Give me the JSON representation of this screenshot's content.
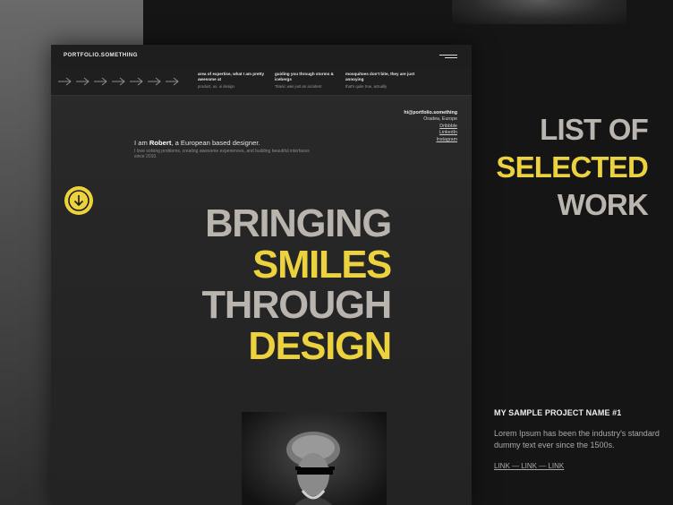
{
  "site": {
    "brand": "PORTFOLIO.SOMETHING",
    "ticker": [
      {
        "head": "area of expertise, what I am pretty awesome at",
        "sub": "product, ux, ui design"
      },
      {
        "head": "guiding you through storms & icebergs",
        "sub": "Titanic was just an accident"
      },
      {
        "head": "mosquitoes don't bite, they are just annoying",
        "sub": "that's quite true, actually"
      }
    ],
    "contact": {
      "email": "hi@portfolio.something",
      "location": "Oradea, Europe",
      "links": [
        "Dribbble",
        "LinkedIn",
        "Instagram"
      ]
    },
    "intro": {
      "prefix": "I am ",
      "name": "Robert",
      "suffix": ", a European based designer.",
      "description": "I love solving problems, creating awesome experiences, and building beautiful interfaces since 2010."
    },
    "hero": [
      "BRINGING",
      "SMILES",
      "THROUGH",
      "DESIGN"
    ]
  },
  "showcase": {
    "title": [
      "LIST OF",
      "SELECTED",
      "WORK"
    ],
    "project": {
      "name": "MY SAMPLE PROJECT NAME #1",
      "description": "Lorem Ipsum has been the industry's standard dummy text ever since the 1500s.",
      "links": "LINK — LINK — LINK"
    }
  },
  "colors": {
    "accent": "#ecd23f",
    "headline_gray": "#b9b4ad",
    "background": "#151515"
  },
  "icons": {
    "scroll": "arrow-down-circle-icon",
    "menu": "hamburger-menu-icon",
    "ticker": "arrow-right-icon"
  }
}
